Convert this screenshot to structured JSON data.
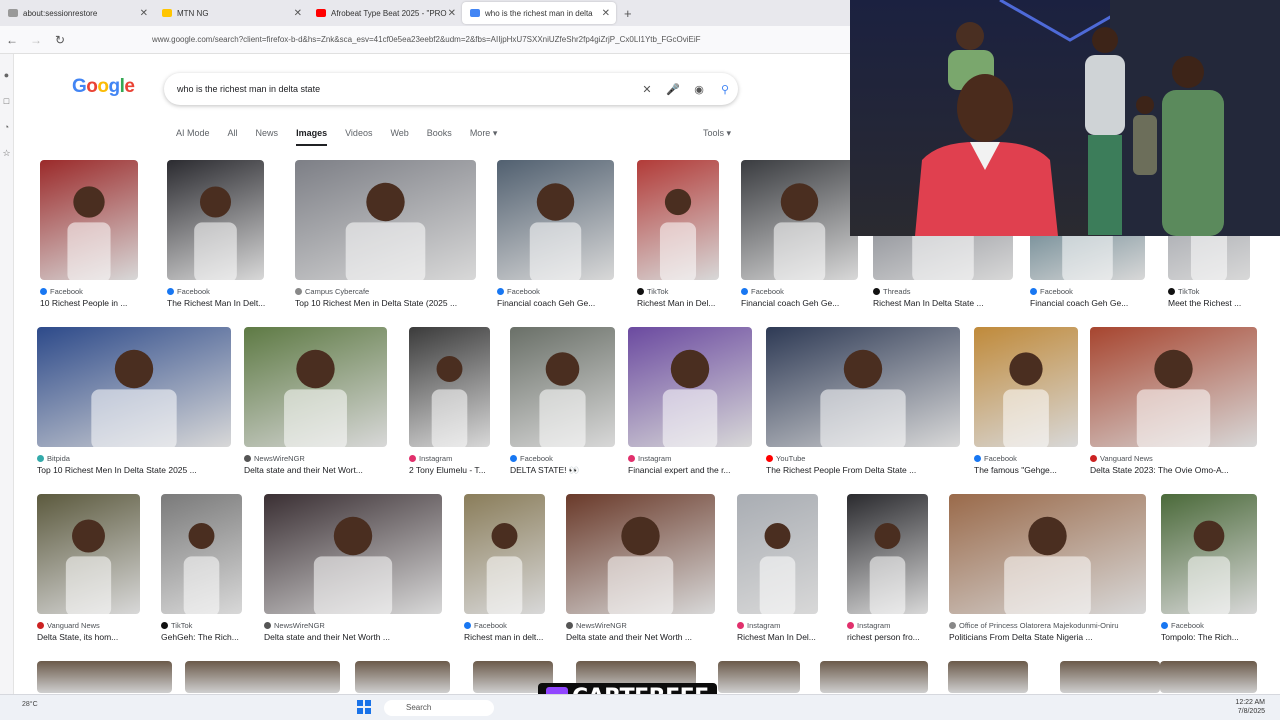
{
  "tabs": [
    {
      "label": "about:sessionrestore",
      "color": "#999"
    },
    {
      "label": "MTN NG",
      "color": "#ffc500"
    },
    {
      "label": "Afrobeat Type Beat 2025 - \"PRO",
      "color": "#ff0000"
    },
    {
      "label": "who is the richest man in delta",
      "color": "#4285f4"
    }
  ],
  "url": "www.google.com/search?client=firefox-b-d&hs=Znk&sca_esv=41cf0e5ea23eebf2&udm=2&fbs=AIIjpHxU7SXXniUZfeShr2fp4giZrjP_Cx0LI1Ytb_FGcOviEiF",
  "search": {
    "query": "who is the richest man in delta state"
  },
  "search_tabs": [
    "AI Mode",
    "All",
    "News",
    "Images",
    "Videos",
    "Web",
    "Books",
    "More ▾"
  ],
  "tools_label": "Tools ▾",
  "results": [
    {
      "source": "Facebook",
      "title": "10 Richest People in ...",
      "c": "#9b2a2a"
    },
    {
      "source": "Facebook",
      "title": "The Richest Man In Delt...",
      "c": "#2b2b30"
    },
    {
      "source": "Campus Cybercafe",
      "title": "Top 10 Richest Men in Delta State (2025 ...",
      "c": "#7d7f86"
    },
    {
      "source": "Facebook",
      "title": "Financial coach Geh Ge...",
      "c": "#516070"
    },
    {
      "source": "TikTok",
      "title": "Richest Man in Del...",
      "c": "#b23b38"
    },
    {
      "source": "Facebook",
      "title": "Financial coach Geh Ge...",
      "c": "#3a3c40"
    },
    {
      "source": "Threads",
      "title": "Richest Man In Delta State ...",
      "c": "#6a6e78"
    },
    {
      "source": "Facebook",
      "title": "Financial coach Geh Ge...",
      "c": "#2f5a6b"
    },
    {
      "source": "TikTok",
      "title": "Meet the Richest ...",
      "c": "#8b8f98"
    },
    {
      "source": "Bitpida",
      "title": "Top 10 Richest Men In Delta State 2025 ...",
      "c": "#2d4a8a"
    },
    {
      "source": "NewsWireNGR",
      "title": "Delta state and their Net Wort...",
      "c": "#5e7a44"
    },
    {
      "source": "Instagram",
      "title": "2 Tony Elumelu - T...",
      "c": "#3b3b3b"
    },
    {
      "source": "Facebook",
      "title": "DELTA STATE! 👀",
      "c": "#6a7068"
    },
    {
      "source": "Instagram",
      "title": "Financial expert and the r...",
      "c": "#6b4aa0"
    },
    {
      "source": "YouTube",
      "title": "The Richest People From Delta State ...",
      "c": "#2e3a55"
    },
    {
      "source": "Facebook",
      "title": "The famous \"Gehge...",
      "c": "#c08a3a"
    },
    {
      "source": "Vanguard News",
      "title": "Delta State 2023: The Ovie Omo-A...",
      "c": "#a7452f"
    },
    {
      "source": "Vanguard News",
      "title": "Delta State, its hom...",
      "c": "#5c5a3e"
    },
    {
      "source": "TikTok",
      "title": "GehGeh: The Rich...",
      "c": "#7a7a7a"
    },
    {
      "source": "NewsWireNGR",
      "title": "Delta state and their Net Worth ...",
      "c": "#3a2f33"
    },
    {
      "source": "Facebook",
      "title": "Richest man in delt...",
      "c": "#8a7d5a"
    },
    {
      "source": "NewsWireNGR",
      "title": "Delta state and their Net Worth ...",
      "c": "#6a3a2a"
    },
    {
      "source": "Instagram",
      "title": "Richest Man In Del...",
      "c": "#a9adb3"
    },
    {
      "source": "Instagram",
      "title": "richest person fro...",
      "c": "#2a2a2e"
    },
    {
      "source": "Office of Princess Olatorera Majekodunmi-Oniru",
      "title": "Politicians From Delta State Nigeria ...",
      "c": "#9a6a4a"
    },
    {
      "source": "Facebook",
      "title": "Tompolo: The Rich...",
      "c": "#4b6a3a"
    }
  ],
  "taskbar": {
    "weather": "28°C",
    "search": "Search",
    "time": "12:22 AM",
    "date": "7/8/2025"
  },
  "stream_tag": "CARTEREFE"
}
